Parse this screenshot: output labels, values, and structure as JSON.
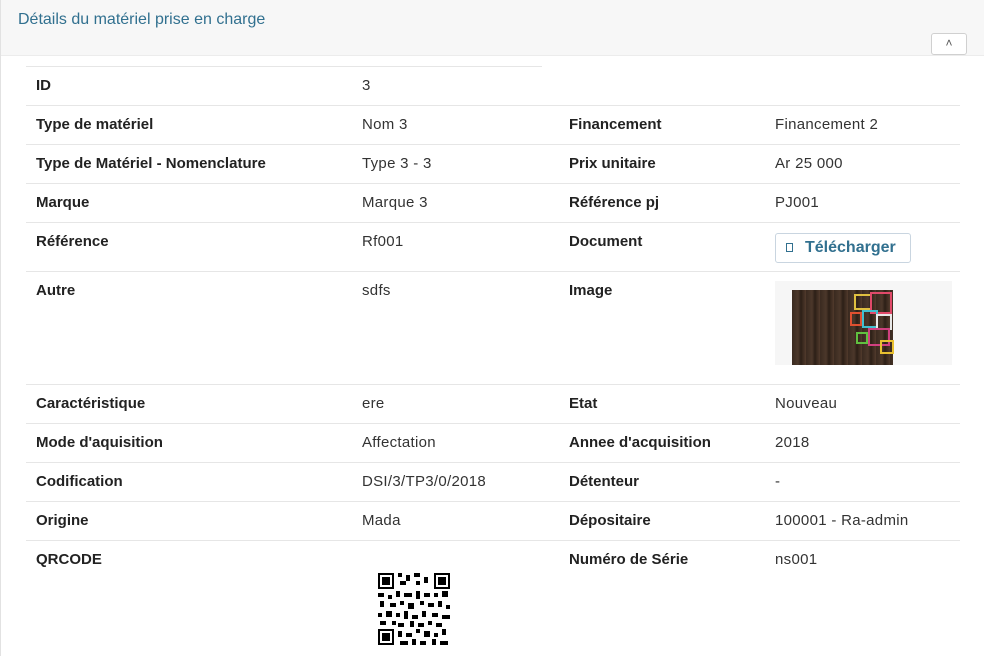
{
  "panel": {
    "title": "Détails du matériel prise en charge",
    "collapse_icon": "chevron-up-icon",
    "collapse_glyph": "˄"
  },
  "details": {
    "id": {
      "label": "ID",
      "value": "3"
    },
    "type_materiel": {
      "label": "Type de matériel",
      "value": "Nom 3"
    },
    "financement": {
      "label": "Financement",
      "value": "Financement 2"
    },
    "nomenclature": {
      "label": "Type de Matériel - Nomenclature",
      "value": "Type 3 - 3"
    },
    "prix_unitaire": {
      "label": "Prix unitaire",
      "value": "Ar 25 000"
    },
    "marque": {
      "label": "Marque",
      "value": "Marque 3"
    },
    "reference_pj": {
      "label": "Référence pj",
      "value": "PJ001"
    },
    "reference": {
      "label": "Référence",
      "value": "Rf001"
    },
    "document": {
      "label": "Document",
      "button_label": "Télécharger",
      "button_icon": "file-icon"
    },
    "autre": {
      "label": "Autre",
      "value": "sdfs"
    },
    "image": {
      "label": "Image"
    },
    "caracteristique": {
      "label": "Caractéristique",
      "value": "ere"
    },
    "etat": {
      "label": "Etat",
      "value": "Nouveau"
    },
    "mode_acquisition": {
      "label": "Mode d'aquisition",
      "value": "Affectation"
    },
    "annee_acquisition": {
      "label": "Annee d'acquisition",
      "value": "2018"
    },
    "codification": {
      "label": "Codification",
      "value": "DSI/3/TP3/0/2018"
    },
    "detenteur": {
      "label": "Détenteur",
      "value": "-"
    },
    "origine": {
      "label": "Origine",
      "value": "Mada"
    },
    "depositaire": {
      "label": "Dépositaire",
      "value": "100001 - Ra-admin"
    },
    "qrcode": {
      "label": "QRCODE"
    },
    "numero_serie": {
      "label": "Numéro de Série",
      "value": "ns001"
    }
  }
}
